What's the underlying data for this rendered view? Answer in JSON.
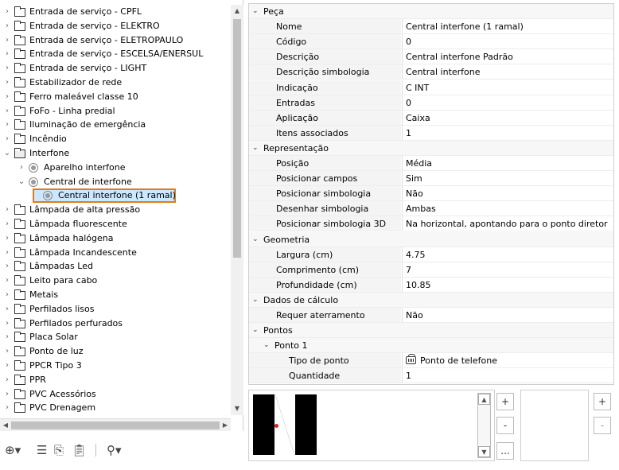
{
  "tree": {
    "items": [
      {
        "label": "Entrada de serviço - CPFL",
        "indent": 0,
        "type": "folder",
        "chevron": "›"
      },
      {
        "label": "Entrada de serviço - ELEKTRO",
        "indent": 0,
        "type": "folder",
        "chevron": "›"
      },
      {
        "label": "Entrada de serviço - ELETROPAULO",
        "indent": 0,
        "type": "folder",
        "chevron": "›"
      },
      {
        "label": "Entrada de serviço - ESCELSA/ENERSUL",
        "indent": 0,
        "type": "folder",
        "chevron": "›"
      },
      {
        "label": "Entrada de serviço - LIGHT",
        "indent": 0,
        "type": "folder",
        "chevron": "›"
      },
      {
        "label": "Estabilizador de rede",
        "indent": 0,
        "type": "folder",
        "chevron": "›"
      },
      {
        "label": "Ferro maleável classe 10",
        "indent": 0,
        "type": "folder",
        "chevron": "›"
      },
      {
        "label": "FoFo - Linha predial",
        "indent": 0,
        "type": "folder",
        "chevron": "›"
      },
      {
        "label": "Iluminação de emergência",
        "indent": 0,
        "type": "folder",
        "chevron": "›"
      },
      {
        "label": "Incêndio",
        "indent": 0,
        "type": "folder",
        "chevron": "›"
      },
      {
        "label": "Interfone",
        "indent": 0,
        "type": "folder-open",
        "chevron": "⌄"
      },
      {
        "label": "Aparelho interfone",
        "indent": 1,
        "type": "item",
        "chevron": "›"
      },
      {
        "label": "Central de interfone",
        "indent": 1,
        "type": "item",
        "chevron": "⌄"
      },
      {
        "label": "Central interfone (1 ramal)",
        "indent": 2,
        "type": "item",
        "chevron": "",
        "selected": true
      },
      {
        "label": "Lâmpada de alta pressão",
        "indent": 0,
        "type": "folder",
        "chevron": "›"
      },
      {
        "label": "Lâmpada fluorescente",
        "indent": 0,
        "type": "folder",
        "chevron": "›"
      },
      {
        "label": "Lâmpada halógena",
        "indent": 0,
        "type": "folder",
        "chevron": "›"
      },
      {
        "label": "Lâmpada Incandescente",
        "indent": 0,
        "type": "folder",
        "chevron": "›"
      },
      {
        "label": "Lâmpadas Led",
        "indent": 0,
        "type": "folder",
        "chevron": "›"
      },
      {
        "label": "Leito para cabo",
        "indent": 0,
        "type": "folder",
        "chevron": "›"
      },
      {
        "label": "Metais",
        "indent": 0,
        "type": "folder",
        "chevron": "›"
      },
      {
        "label": "Perfilados lisos",
        "indent": 0,
        "type": "folder",
        "chevron": "›"
      },
      {
        "label": "Perfilados perfurados",
        "indent": 0,
        "type": "folder",
        "chevron": "›"
      },
      {
        "label": "Placa Solar",
        "indent": 0,
        "type": "folder",
        "chevron": "›"
      },
      {
        "label": "Ponto de luz",
        "indent": 0,
        "type": "folder",
        "chevron": "›"
      },
      {
        "label": "PPCR Tipo 3",
        "indent": 0,
        "type": "folder",
        "chevron": "›"
      },
      {
        "label": "PPR",
        "indent": 0,
        "type": "folder",
        "chevron": "›"
      },
      {
        "label": "PVC Acessórios",
        "indent": 0,
        "type": "folder",
        "chevron": "›"
      },
      {
        "label": "PVC Drenagem",
        "indent": 0,
        "type": "folder",
        "chevron": "›"
      }
    ],
    "highlight_color": "#e07b1a",
    "selection_color": "#cce8ff"
  },
  "toolbar": {
    "icons": [
      "add-item-icon",
      "indent-icon",
      "copy-icon",
      "paste-icon",
      "filter-icon"
    ]
  },
  "properties": {
    "rows": [
      {
        "kind": "cat",
        "level": 0,
        "label": "Peça"
      },
      {
        "kind": "prop",
        "level": 1,
        "name": "Nome",
        "value": "Central interfone (1 ramal)"
      },
      {
        "kind": "prop",
        "level": 1,
        "name": "Código",
        "value": "0"
      },
      {
        "kind": "prop",
        "level": 1,
        "name": "Descrição",
        "value": "Central interfone Padrão"
      },
      {
        "kind": "prop",
        "level": 1,
        "name": "Descrição simbologia",
        "value": "Central interfone"
      },
      {
        "kind": "prop",
        "level": 1,
        "name": "Indicação",
        "value": "C INT"
      },
      {
        "kind": "prop",
        "level": 1,
        "name": "Entradas",
        "value": "0"
      },
      {
        "kind": "prop",
        "level": 1,
        "name": "Aplicação",
        "value": "Caixa"
      },
      {
        "kind": "prop",
        "level": 1,
        "name": "Itens associados",
        "value": "1"
      },
      {
        "kind": "cat",
        "level": 0,
        "label": "Representação"
      },
      {
        "kind": "prop",
        "level": 1,
        "name": "Posição",
        "value": "Média"
      },
      {
        "kind": "prop",
        "level": 1,
        "name": "Posicionar campos",
        "value": "Sim"
      },
      {
        "kind": "prop",
        "level": 1,
        "name": "Posicionar simbologia",
        "value": "Não"
      },
      {
        "kind": "prop",
        "level": 1,
        "name": "Desenhar simbologia",
        "value": "Ambas"
      },
      {
        "kind": "prop",
        "level": 1,
        "name": "Posicionar simbologia 3D",
        "value": "Na horizontal, apontando para o ponto diretor"
      },
      {
        "kind": "cat",
        "level": 0,
        "label": "Geometria"
      },
      {
        "kind": "prop",
        "level": 1,
        "name": "Largura (cm)",
        "value": "4.75"
      },
      {
        "kind": "prop",
        "level": 1,
        "name": "Comprimento (cm)",
        "value": "7"
      },
      {
        "kind": "prop",
        "level": 1,
        "name": "Profundidade (cm)",
        "value": "10.85"
      },
      {
        "kind": "cat",
        "level": 0,
        "label": "Dados de cálculo"
      },
      {
        "kind": "prop",
        "level": 1,
        "name": "Requer aterramento",
        "value": "Não"
      },
      {
        "kind": "cat",
        "level": 0,
        "label": "Pontos"
      },
      {
        "kind": "cat",
        "level": 1,
        "label": "Ponto 1"
      },
      {
        "kind": "prop",
        "level": 2,
        "name": "Tipo de ponto",
        "value": "Ponto de telefone",
        "icon": "telephone-icon"
      },
      {
        "kind": "prop",
        "level": 2,
        "name": "Quantidade",
        "value": "1"
      }
    ]
  },
  "preview": {
    "buttons": {
      "plus": "+",
      "minus": "-",
      "more": "..."
    },
    "mini_buttons": {
      "plus": "+",
      "minus": "-"
    }
  }
}
